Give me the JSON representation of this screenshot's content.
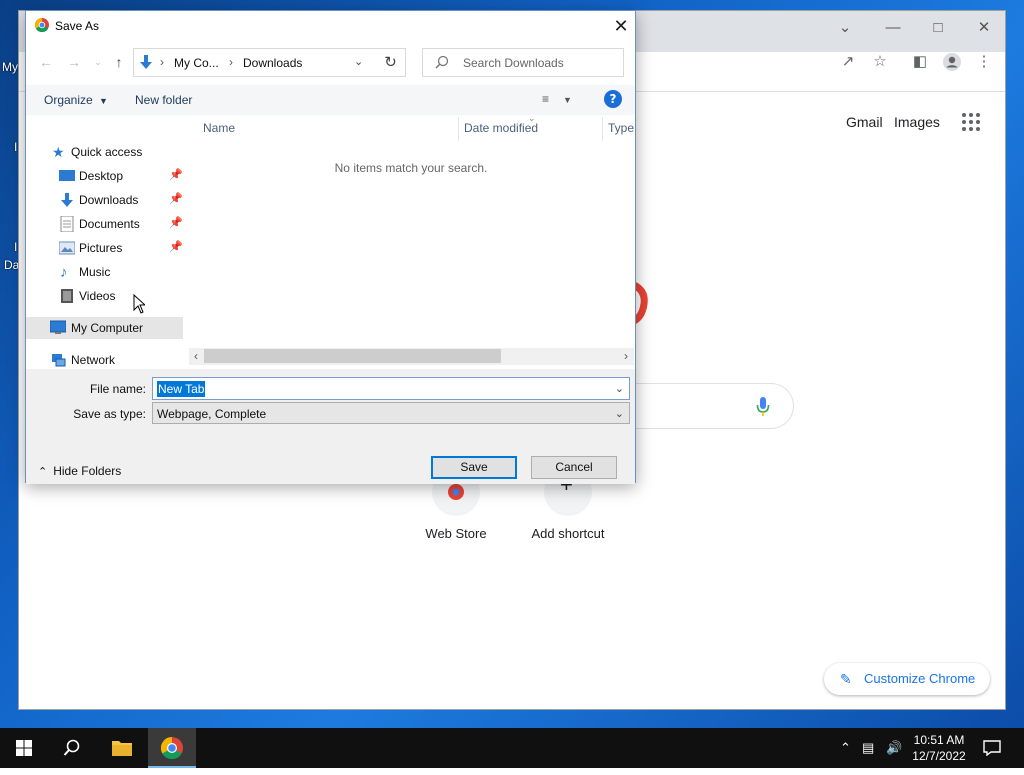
{
  "dialog": {
    "title": "Save As",
    "address": {
      "crumb1": "My Co...",
      "crumb2": "Downloads"
    },
    "search": {
      "placeholder": "Search Downloads"
    },
    "commands": {
      "organize": "Organize",
      "new_folder": "New folder"
    },
    "nav_pane": {
      "quick_access": "Quick access",
      "items": [
        {
          "label": "Desktop",
          "icon": "desktop-icon",
          "pinned": true
        },
        {
          "label": "Downloads",
          "icon": "download-icon",
          "pinned": true
        },
        {
          "label": "Documents",
          "icon": "documents-icon",
          "pinned": true
        },
        {
          "label": "Pictures",
          "icon": "pictures-icon",
          "pinned": true
        },
        {
          "label": "Music",
          "icon": "music-icon",
          "pinned": false
        },
        {
          "label": "Videos",
          "icon": "videos-icon",
          "pinned": false
        }
      ],
      "my_computer": "My Computer",
      "network": "Network"
    },
    "columns": [
      "Name",
      "Date modified",
      "Type"
    ],
    "empty_message": "No items match your search.",
    "file_name_label": "File name:",
    "file_name_value": "New Tab",
    "save_type_label": "Save as type:",
    "save_type_value": "Webpage, Complete",
    "hide_folders": "Hide Folders",
    "save_button": "Save",
    "cancel_button": "Cancel"
  },
  "browser": {
    "links": {
      "gmail": "Gmail",
      "images": "Images"
    },
    "shortcuts": [
      {
        "label": "Web Store"
      },
      {
        "label": "Add shortcut"
      }
    ],
    "customize": "Customize Chrome"
  },
  "desktop": {
    "label1": "My",
    "label2": "Da"
  },
  "taskbar": {
    "time": "10:51 AM",
    "date": "12/7/2022"
  },
  "colors": {
    "accent": "#0078d7",
    "google_blue": "#1a73e8"
  }
}
